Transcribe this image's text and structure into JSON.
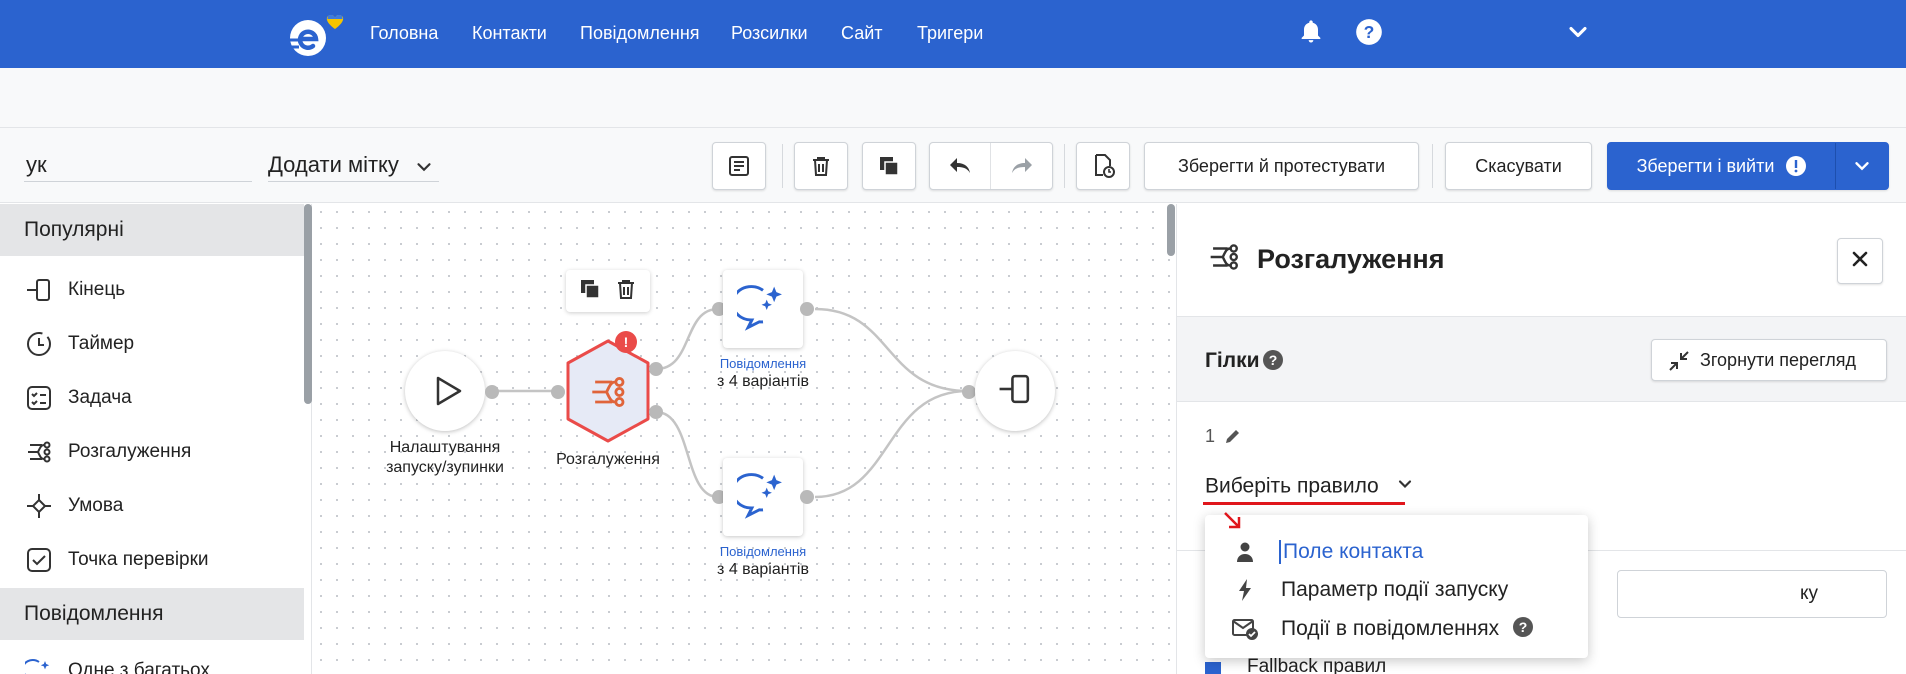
{
  "nav": {
    "items": [
      "Головна",
      "Контакти",
      "Повідомлення",
      "Розсилки",
      "Сайт",
      "Тригери"
    ],
    "icons": [
      "bell-icon",
      "help-icon",
      "chevron-down-icon"
    ],
    "brand_color": "#2b63cf"
  },
  "toolbar": {
    "name_value": "ук",
    "add_tag_label": "Додати мітку",
    "save_test_label": "Зберегти й протестувати",
    "cancel_label": "Скасувати",
    "save_exit_label": "Зберегти і вийти"
  },
  "palette": {
    "sections": [
      {
        "title": "Популярні",
        "items": [
          {
            "label": "Кінець",
            "icon": "end-icon"
          },
          {
            "label": "Таймер",
            "icon": "timer-icon"
          },
          {
            "label": "Задача",
            "icon": "task-icon"
          },
          {
            "label": "Розгалуження",
            "icon": "branch-icon"
          },
          {
            "label": "Умова",
            "icon": "condition-icon"
          },
          {
            "label": "Точка перевірки",
            "icon": "checkpoint-icon"
          }
        ]
      },
      {
        "title": "Повідомлення",
        "items": [
          {
            "label": "Одне з багатьох",
            "icon": "ai-message-icon"
          }
        ]
      }
    ]
  },
  "canvas": {
    "nodes": {
      "start": {
        "label_line1": "Налаштування",
        "label_line2": "запуску/зупинки"
      },
      "branch": {
        "label": "Розгалуження",
        "badge": "!"
      },
      "message_top": {
        "caption": "Повідомлення",
        "label": "з 4 варіантів"
      },
      "message_bottom": {
        "caption": "Повідомлення",
        "label": "з 4 варіантів"
      }
    }
  },
  "panel": {
    "title": "Розгалуження",
    "branches_label": "Гілки",
    "collapse_label": "Згорнути перегляд",
    "branch_number": "1",
    "rule_select": "Виберіть правило",
    "bg_field_tail": "ку",
    "fallback_label": "Fallback правил"
  },
  "dropdown": {
    "items": [
      {
        "label": "Поле контакта",
        "icon": "person-icon",
        "selected": true
      },
      {
        "label": "Параметр події запуску",
        "icon": "lightning-icon",
        "selected": false
      },
      {
        "label": "Події в повідомленнях",
        "icon": "mail-check-icon",
        "selected": false
      }
    ]
  }
}
